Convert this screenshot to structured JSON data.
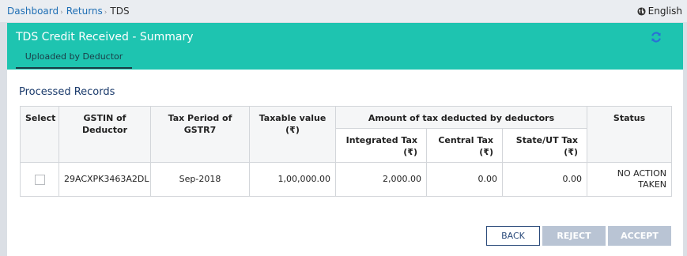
{
  "breadcrumb": {
    "items": [
      {
        "label": "Dashboard"
      },
      {
        "label": "Returns"
      }
    ],
    "current": "TDS"
  },
  "language": {
    "label": "English",
    "icon": "globe-icon"
  },
  "header": {
    "title": "TDS Credit Received - Summary",
    "tab_label": "Uploaded by Deductor",
    "refresh_icon": "refresh-icon",
    "color": "#1ec4b0"
  },
  "section": {
    "title": "Processed Records"
  },
  "table": {
    "headers": {
      "select": "Select",
      "gstin": "GSTIN of Deductor",
      "tax_period": "Tax Period of GSTR7",
      "taxable_value": "Taxable value (₹)",
      "amount_group": "Amount of tax deducted by deductors",
      "integrated_tax": "Integrated Tax (₹)",
      "central_tax": "Central Tax (₹)",
      "state_ut_tax": "State/UT Tax (₹)",
      "status": "Status"
    },
    "rows": [
      {
        "selected": false,
        "gstin": "29ACXPK3463A2DL",
        "tax_period": "Sep-2018",
        "taxable_value": "1,00,000.00",
        "integrated_tax": "2,000.00",
        "central_tax": "0.00",
        "state_ut_tax": "0.00",
        "status": "NO ACTION TAKEN"
      }
    ]
  },
  "buttons": {
    "back": "BACK",
    "reject": "REJECT",
    "accept": "ACCEPT"
  }
}
